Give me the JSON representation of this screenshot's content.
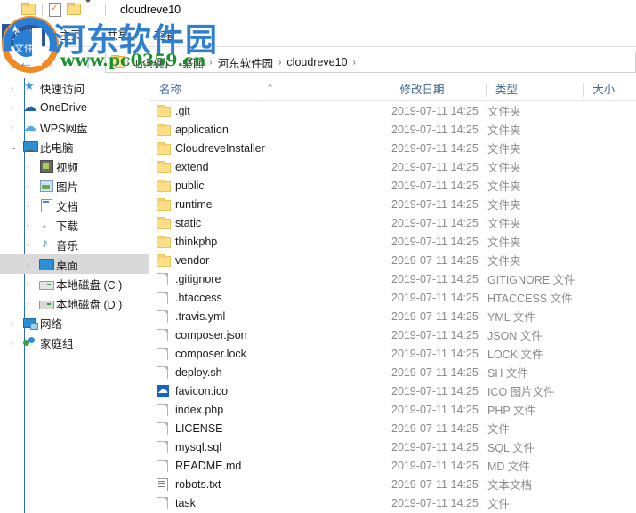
{
  "window": {
    "title": "cloudreve10"
  },
  "quick_access_toolbar": {
    "items": [
      {
        "name": "folder-icon",
        "label": ""
      },
      {
        "name": "properties-icon",
        "label": ""
      },
      {
        "name": "new-folder-icon",
        "label": ""
      },
      {
        "name": "chevron-down-icon",
        "label": ""
      }
    ]
  },
  "ribbon": {
    "tabs": [
      {
        "label": "文件",
        "active": true
      },
      {
        "label": "主页",
        "active": false
      },
      {
        "label": "共享",
        "active": false
      },
      {
        "label": "查看",
        "active": false
      }
    ]
  },
  "navbar": {
    "back_label": "←",
    "forward_label": "→",
    "recent_label": "▾",
    "up_label": "↑",
    "breadcrumb": [
      "此电脑",
      "桌面",
      "河东软件园",
      "cloudreve10"
    ],
    "separator": "›"
  },
  "nav_pane": {
    "items": [
      {
        "label": "快速访问",
        "icon": "star-icon",
        "level": 1,
        "chevron": "closed",
        "selected": false
      },
      {
        "label": "OneDrive",
        "icon": "onedrive-cloud-icon",
        "level": 1,
        "chevron": "closed",
        "selected": false
      },
      {
        "label": "WPS网盘",
        "icon": "wps-cloud-icon",
        "level": 1,
        "chevron": "closed",
        "selected": false
      },
      {
        "label": "此电脑",
        "icon": "this-pc-icon",
        "level": 1,
        "chevron": "open",
        "selected": false
      },
      {
        "label": "视频",
        "icon": "videos-icon",
        "level": 2,
        "chevron": "closed",
        "selected": false
      },
      {
        "label": "图片",
        "icon": "pictures-icon",
        "level": 2,
        "chevron": "closed",
        "selected": false
      },
      {
        "label": "文档",
        "icon": "documents-icon",
        "level": 2,
        "chevron": "closed",
        "selected": false
      },
      {
        "label": "下载",
        "icon": "downloads-icon",
        "level": 2,
        "chevron": "closed",
        "selected": false
      },
      {
        "label": "音乐",
        "icon": "music-icon",
        "level": 2,
        "chevron": "closed",
        "selected": false
      },
      {
        "label": "桌面",
        "icon": "desktop-icon",
        "level": 2,
        "chevron": "closed",
        "selected": true
      },
      {
        "label": "本地磁盘 (C:)",
        "icon": "system-drive-icon",
        "level": 2,
        "chevron": "closed",
        "selected": false
      },
      {
        "label": "本地磁盘 (D:)",
        "icon": "drive-icon",
        "level": 2,
        "chevron": "closed",
        "selected": false
      },
      {
        "label": "网络",
        "icon": "network-icon",
        "level": 1,
        "chevron": "closed",
        "selected": false
      },
      {
        "label": "家庭组",
        "icon": "homegroup-icon",
        "level": 1,
        "chevron": "closed",
        "selected": false
      }
    ]
  },
  "file_list": {
    "columns": [
      {
        "label": "名称",
        "key": "name",
        "sorted": "asc"
      },
      {
        "label": "修改日期",
        "key": "date",
        "sorted": ""
      },
      {
        "label": "类型",
        "key": "type",
        "sorted": ""
      },
      {
        "label": "大小",
        "key": "size",
        "sorted": ""
      }
    ],
    "sort_arrow": "˄",
    "rows": [
      {
        "name": ".git",
        "date": "2019-07-11 14:25",
        "type": "文件夹",
        "size": "",
        "icon": "folder-icon"
      },
      {
        "name": "application",
        "date": "2019-07-11 14:25",
        "type": "文件夹",
        "size": "",
        "icon": "folder-icon"
      },
      {
        "name": "CloudreveInstaller",
        "date": "2019-07-11 14:25",
        "type": "文件夹",
        "size": "",
        "icon": "folder-icon"
      },
      {
        "name": "extend",
        "date": "2019-07-11 14:25",
        "type": "文件夹",
        "size": "",
        "icon": "folder-icon"
      },
      {
        "name": "public",
        "date": "2019-07-11 14:25",
        "type": "文件夹",
        "size": "",
        "icon": "folder-icon"
      },
      {
        "name": "runtime",
        "date": "2019-07-11 14:25",
        "type": "文件夹",
        "size": "",
        "icon": "folder-icon"
      },
      {
        "name": "static",
        "date": "2019-07-11 14:25",
        "type": "文件夹",
        "size": "",
        "icon": "folder-icon"
      },
      {
        "name": "thinkphp",
        "date": "2019-07-11 14:25",
        "type": "文件夹",
        "size": "",
        "icon": "folder-icon"
      },
      {
        "name": "vendor",
        "date": "2019-07-11 14:25",
        "type": "文件夹",
        "size": "",
        "icon": "folder-icon"
      },
      {
        "name": ".gitignore",
        "date": "2019-07-11 14:25",
        "type": "GITIGNORE 文件",
        "size": "",
        "icon": "file-icon"
      },
      {
        "name": ".htaccess",
        "date": "2019-07-11 14:25",
        "type": "HTACCESS 文件",
        "size": "",
        "icon": "file-icon"
      },
      {
        "name": ".travis.yml",
        "date": "2019-07-11 14:25",
        "type": "YML 文件",
        "size": "",
        "icon": "file-icon"
      },
      {
        "name": "composer.json",
        "date": "2019-07-11 14:25",
        "type": "JSON 文件",
        "size": "",
        "icon": "file-icon"
      },
      {
        "name": "composer.lock",
        "date": "2019-07-11 14:25",
        "type": "LOCK 文件",
        "size": "",
        "icon": "file-icon"
      },
      {
        "name": "deploy.sh",
        "date": "2019-07-11 14:25",
        "type": "SH 文件",
        "size": "",
        "icon": "file-icon"
      },
      {
        "name": "favicon.ico",
        "date": "2019-07-11 14:25",
        "type": "ICO 图片文件",
        "size": "",
        "icon": "ico-image-icon"
      },
      {
        "name": "index.php",
        "date": "2019-07-11 14:25",
        "type": "PHP 文件",
        "size": "",
        "icon": "file-icon"
      },
      {
        "name": "LICENSE",
        "date": "2019-07-11 14:25",
        "type": "文件",
        "size": "",
        "icon": "file-icon"
      },
      {
        "name": "mysql.sql",
        "date": "2019-07-11 14:25",
        "type": "SQL 文件",
        "size": "",
        "icon": "file-icon"
      },
      {
        "name": "README.md",
        "date": "2019-07-11 14:25",
        "type": "MD 文件",
        "size": "",
        "icon": "file-icon"
      },
      {
        "name": "robots.txt",
        "date": "2019-07-11 14:25",
        "type": "文本文档",
        "size": "",
        "icon": "text-file-icon"
      },
      {
        "name": "task",
        "date": "2019-07-11 14:25",
        "type": "文件",
        "size": "",
        "icon": "file-icon"
      }
    ]
  },
  "watermark": {
    "site_name": "河东软件园",
    "url": "www.pc0359.cn",
    "logo_caption": "文件"
  },
  "colors": {
    "accent": "#2a6fb8",
    "file_tab": "#2b579a",
    "header_text": "#3f6a8f",
    "selection": "#d9d9d9",
    "watermark_blue": "#2f7fd1",
    "watermark_green": "#1e8f2e"
  }
}
